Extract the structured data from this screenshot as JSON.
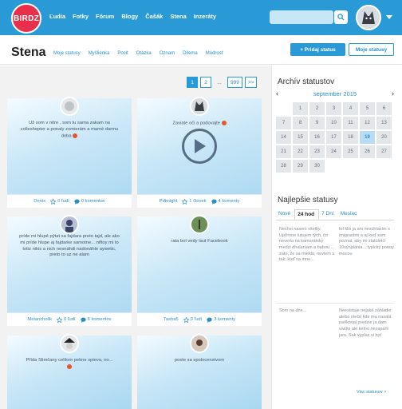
{
  "brand": {
    "logo": "BIRDZ"
  },
  "nav": [
    "Ľudia",
    "Fotky",
    "Fórum",
    "Blogy",
    "Čašák",
    "Stena",
    "Inzeráty"
  ],
  "nav_active": "Stena",
  "page": {
    "title": "Stena",
    "subtabs": [
      "Moje statusy",
      "Myšlienka",
      "Pocit",
      "Otázka",
      "Oznam",
      "Dilema",
      "Múdrosť"
    ],
    "add_button": "+ Pridaj status",
    "mine_button": "Moje statusy"
  },
  "pagination": [
    "1",
    "2",
    "...",
    "999",
    ">>"
  ],
  "cards": [
    {
      "text": "Už som v nitre , som tu sama zakam na colleshepter a ponaly zomierám a mamé darmu doba ",
      "author": "Denix",
      "likes": "0 ľudí",
      "comments": "0 komentov",
      "avatar": "avatar-denix"
    },
    {
      "text": "Zaviate oči a podovajte",
      "author": "Pdknight",
      "likes": "1 človek",
      "comments": "4 komenty",
      "avatar": "avatar-wolf",
      "video": true
    },
    {
      "text": "príde mi hlupé pýtat sa fajdara preto tajd, ale ako mi príde hlupe aj fajdarke samotne... niftoy mi to totiz nikis a nich nesnáhdi nadonáhle aywetic, preto to uz ne alam",
      "author": "Melancholik",
      "likes": "0 ľudí",
      "comments": "6 komentov",
      "avatar": "avatar-mel"
    },
    {
      "text": "rata bol vedy laut   Facebook",
      "author": "Tasha5",
      "likes": "0 ľudí",
      "comments": "3 komenty",
      "avatar": "avatar-tasha"
    },
    {
      "text": "Přída Slimčany celilom pekne spieva, no...",
      "author": "",
      "likes": "",
      "comments": "",
      "avatar": "avatar-pirate"
    },
    {
      "text": "poste sa spolocenstvom",
      "author": "",
      "likes": "",
      "comments": "",
      "avatar": "avatar-girl"
    }
  ],
  "archive": {
    "title": "Archív statustov",
    "month": "september 2015",
    "days": [
      "1",
      "2",
      "3",
      "4",
      "5",
      "6",
      "7",
      "8",
      "9",
      "10",
      "11",
      "12",
      "13",
      "14",
      "15",
      "16",
      "17",
      "18",
      "19",
      "20",
      "21",
      "22",
      "23",
      "24",
      "25",
      "26",
      "27",
      "28",
      "29",
      "30"
    ],
    "today": "19",
    "first_weekday_offset": 1
  },
  "best": {
    "title": "Najlepšie statusy",
    "tabs": [
      "Nové",
      "24 hod",
      "7 Dní",
      "Mesiac"
    ],
    "active_tab": "24 hod",
    "items": [
      "Nechsi naserii všetky. Upřímne lutujem tých, čo neverla na kamarátsky medzi dhalaniam a babou ... zato, že sa mieklo, neviem u tak; koď sa mne...",
      "tol klis ja ani nesúhlasím s imigrantmi a aj keď som poznal, aby mi zlatúlníčí 10sýnjdania... typický ponoy mocou",
      "Som na dne... ",
      "Neexistuje nejaké záhladie alebo niečo kde ma nasala parlkoval predzie ja dam vaélio ale kelno nezaparli jam. Sak vyplaz si byť"
    ],
    "more": "Viac statusov >"
  },
  "colors": {
    "primary": "#2a9ad7",
    "logo": "#e8304a",
    "today": "#b8dcf3"
  },
  "icons": {
    "search": "search-icon",
    "play": "play-icon",
    "star": "star-icon",
    "comment": "comment-icon",
    "emoji": "emoji-icon"
  }
}
